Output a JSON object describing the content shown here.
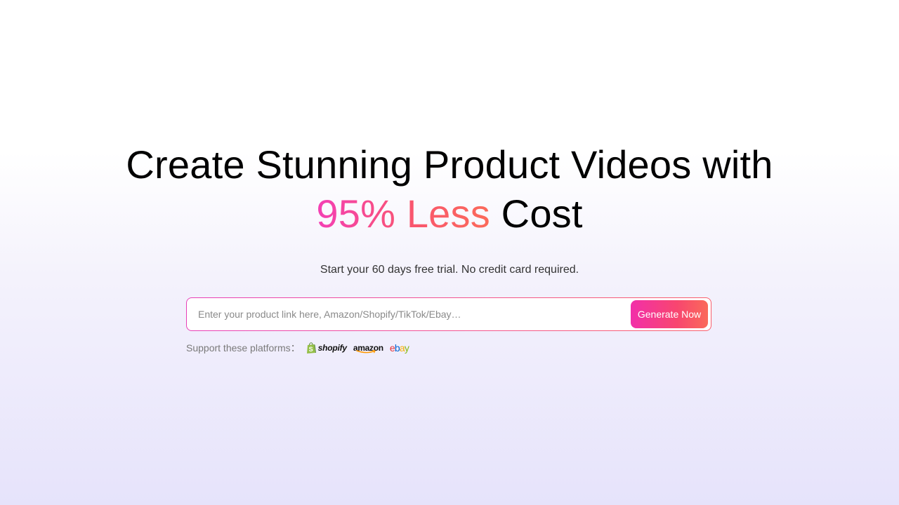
{
  "hero": {
    "headline_line1": "Create Stunning Product Videos with",
    "headline_accent": "95% Less",
    "headline_end": "Cost",
    "subline": "Start your 60 days free trial. No credit card required."
  },
  "search": {
    "value": "",
    "placeholder": "Enter your product link here, Amazon/Shopify/TikTok/Ebay…",
    "button_label": "Generate Now"
  },
  "platforms": {
    "label": "Support these platforms：",
    "logos": {
      "shopify": "shopify",
      "amazon": "amazon",
      "ebay_e": "e",
      "ebay_b": "b",
      "ebay_a": "a",
      "ebay_y": "y"
    }
  },
  "colors": {
    "accent_start": "#f43fb5",
    "accent_end": "#fb6a5a",
    "shopify_green": "#95bf47",
    "amazon_orange": "#ff9900"
  },
  "icons": [
    "shopify-icon",
    "amazon-smile-icon"
  ]
}
